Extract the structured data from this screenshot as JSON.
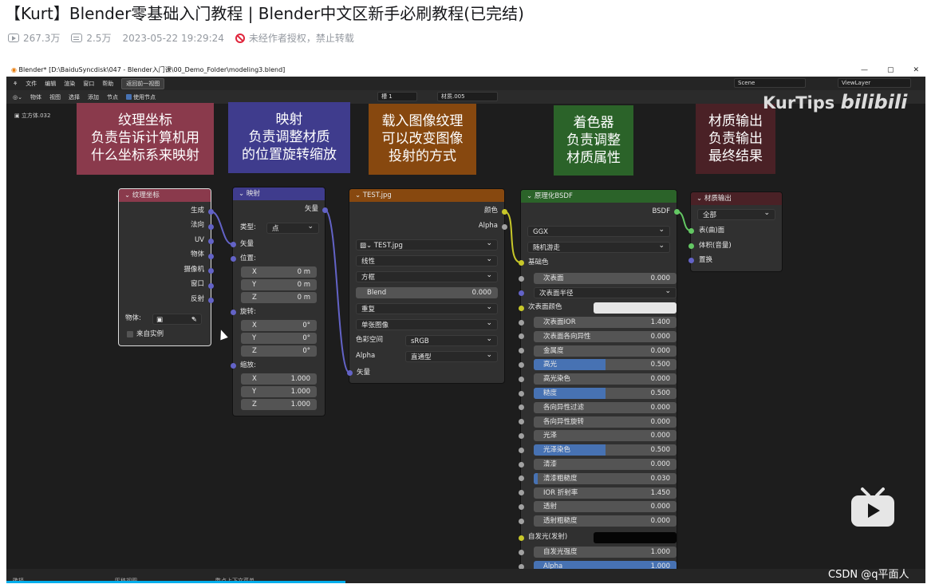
{
  "page": {
    "title": "【Kurt】Blender零基础入门教程 | Blender中文区新手必刷教程(已完结)",
    "views": "267.3万",
    "danmaku": "2.5万",
    "date": "2023-05-22 19:29:24",
    "notice": "未经作者授权，禁止转载"
  },
  "window": {
    "title": "Blender* [D:\\BaiduSyncdisk\\047 - Blender入门课\\00_Demo_Folder\\modeling3.blend]",
    "controls": [
      "—",
      "▢",
      "✕"
    ]
  },
  "menubar": {
    "items": [
      "文件",
      "编辑",
      "渲染",
      "窗口",
      "帮助"
    ],
    "back": "返回前一视图",
    "scene": "Scene",
    "view_layer": "ViewLayer"
  },
  "toolbar": {
    "object_mode": "物体",
    "items": [
      "视图",
      "选择",
      "添加",
      "节点"
    ],
    "use_nodes": "使用节点",
    "slot": "槽 1",
    "material": "材质.005",
    "breadcrumb": "立方体.032"
  },
  "annotations": [
    {
      "text": "纹理坐标\n负责告诉计算机用\n什么坐标系来映射",
      "color": "#8a3a4c"
    },
    {
      "text": "映射\n负责调整材质\n的位置旋转缩放",
      "color": "#3f3c8d"
    },
    {
      "text": "载入图像纹理\n可以改变图像\n投射的方式",
      "color": "#87480f"
    },
    {
      "text": "着色器\n负责调整\n材质属性",
      "color": "#2b6329"
    },
    {
      "text": "材质输出\n负责输出\n最终结果",
      "color": "#4a2126"
    }
  ],
  "watermark": {
    "kurtips": "KurTips",
    "bilibili": "bilibili"
  },
  "nodes": {
    "texcoord": {
      "title": "纹理坐标",
      "outputs": [
        "生成",
        "法向",
        "UV",
        "物体",
        "摄像机",
        "窗口",
        "反射"
      ],
      "object_label": "物体:",
      "from_instancer": "来自实例"
    },
    "mapping": {
      "title": "映射",
      "out": "矢量",
      "type_label": "类型:",
      "type_value": "点",
      "vector": "矢量",
      "location": "位置:",
      "loc": [
        {
          "axis": "X",
          "val": "0 m"
        },
        {
          "axis": "Y",
          "val": "0 m"
        },
        {
          "axis": "Z",
          "val": "0 m"
        }
      ],
      "rotation": "旋转:",
      "rot": [
        {
          "axis": "X",
          "val": "0°"
        },
        {
          "axis": "Y",
          "val": "0°"
        },
        {
          "axis": "Z",
          "val": "0°"
        }
      ],
      "scale": "缩放:",
      "scl": [
        {
          "axis": "X",
          "val": "1.000"
        },
        {
          "axis": "Y",
          "val": "1.000"
        },
        {
          "axis": "Z",
          "val": "1.000"
        }
      ]
    },
    "image": {
      "title": "TEST.jpg",
      "out_color": "颜色",
      "out_alpha": "Alpha",
      "image_name": "TEST.jpg",
      "interp": "线性",
      "projection": "方框",
      "blend_label": "Blend",
      "blend_value": "0.000",
      "extension": "重复",
      "source": "单张图像",
      "colorspace_label": "色彩空间",
      "colorspace": "sRGB",
      "alpha_label": "Alpha",
      "alpha_mode": "直通型",
      "vector": "矢量"
    },
    "bsdf": {
      "title": "原理化BSDF",
      "out": "BSDF",
      "distribution": "GGX",
      "subsurface_method": "随机游走",
      "base_color": "基础色",
      "subsurface": {
        "label": "次表面",
        "value": "0.000"
      },
      "subsurface_radius": "次表面半径",
      "subsurface_color": "次表面颜色",
      "rows": [
        {
          "label": "次表面IOR",
          "value": "1.400",
          "fill": 0.0
        },
        {
          "label": "次表面各向异性",
          "value": "0.000",
          "fill": 0.0
        },
        {
          "label": "金属度",
          "value": "0.000",
          "fill": 0.0
        },
        {
          "label": "高光",
          "value": "0.500",
          "fill": 0.5
        },
        {
          "label": "高光染色",
          "value": "0.000",
          "fill": 0.0
        },
        {
          "label": "糙度",
          "value": "0.500",
          "fill": 0.5
        },
        {
          "label": "各向异性过滤",
          "value": "0.000",
          "fill": 0.0
        },
        {
          "label": "各向异性旋转",
          "value": "0.000",
          "fill": 0.0
        },
        {
          "label": "光泽",
          "value": "0.000",
          "fill": 0.0
        },
        {
          "label": "光泽染色",
          "value": "0.500",
          "fill": 0.5
        },
        {
          "label": "清漆",
          "value": "0.000",
          "fill": 0.0
        },
        {
          "label": "清漆粗糙度",
          "value": "0.030",
          "fill": 0.03
        },
        {
          "label": "IOR 折射率",
          "value": "1.450",
          "fill": 0.0
        },
        {
          "label": "透射",
          "value": "0.000",
          "fill": 0.0
        },
        {
          "label": "透射粗糙度",
          "value": "0.000",
          "fill": 0.0
        }
      ],
      "emission": "自发光(发射)",
      "emission_strength": {
        "label": "自发光强度",
        "value": "1.000"
      },
      "alpha": {
        "label": "Alpha",
        "value": "1.000"
      }
    },
    "output": {
      "title": "材质输出",
      "target": "全部",
      "inputs": [
        "表(曲)面",
        "体积(音量)",
        "置换"
      ]
    }
  },
  "statusbar": {
    "select": "选择",
    "pan": "平移视图",
    "context": "节点上下文菜单"
  },
  "csdn": "CSDN @q平面人"
}
